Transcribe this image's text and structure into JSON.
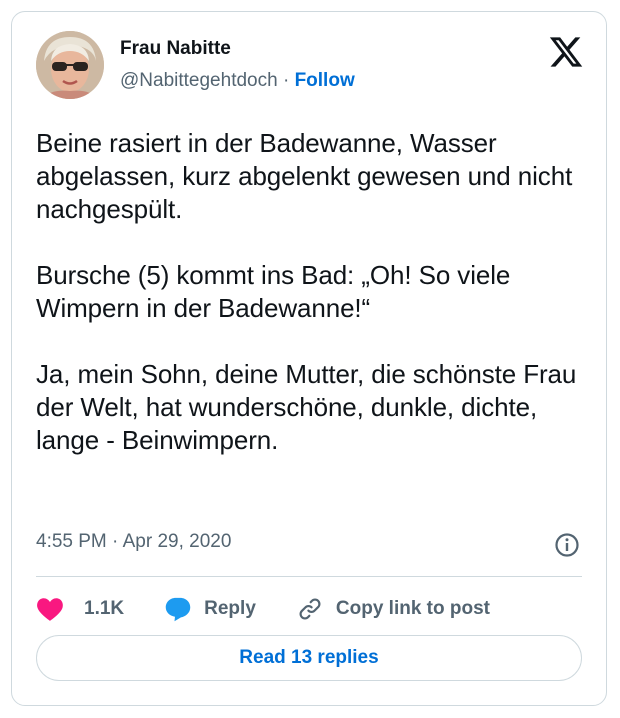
{
  "author": {
    "name": "Frau Nabitte",
    "handle": "@Nabittegehtdoch",
    "separator": "·",
    "follow_label": "Follow"
  },
  "tweet": {
    "text": "Beine rasiert in der Badewanne, Wasser abgelassen, kurz abgelenkt gewesen und nicht nachgespült.\n\nBursche (5) kommt ins Bad: „Oh! So viele Wimpern in der Badewanne!“\n\nJa, mein Sohn, deine Mutter, die schönste Frau der Welt, hat wunderschöne, dunkle, dichte, lange - Beinwimpern.",
    "time": "4:55 PM",
    "date_separator": "·",
    "date": "Apr 29, 2020"
  },
  "actions": {
    "like_count": "1.1K",
    "reply_label": "Reply",
    "copy_label": "Copy link to post",
    "read_replies_label": "Read 13 replies"
  },
  "icons": {
    "logo": "x-logo-icon",
    "like": "heart-icon",
    "reply": "speech-bubble-icon",
    "copy": "link-icon",
    "info": "info-icon"
  },
  "colors": {
    "like": "#f91880",
    "reply": "#1d9bf0",
    "link": "#006fd6",
    "muted": "#536471",
    "text": "#0f1419",
    "border": "#cfd9de"
  }
}
